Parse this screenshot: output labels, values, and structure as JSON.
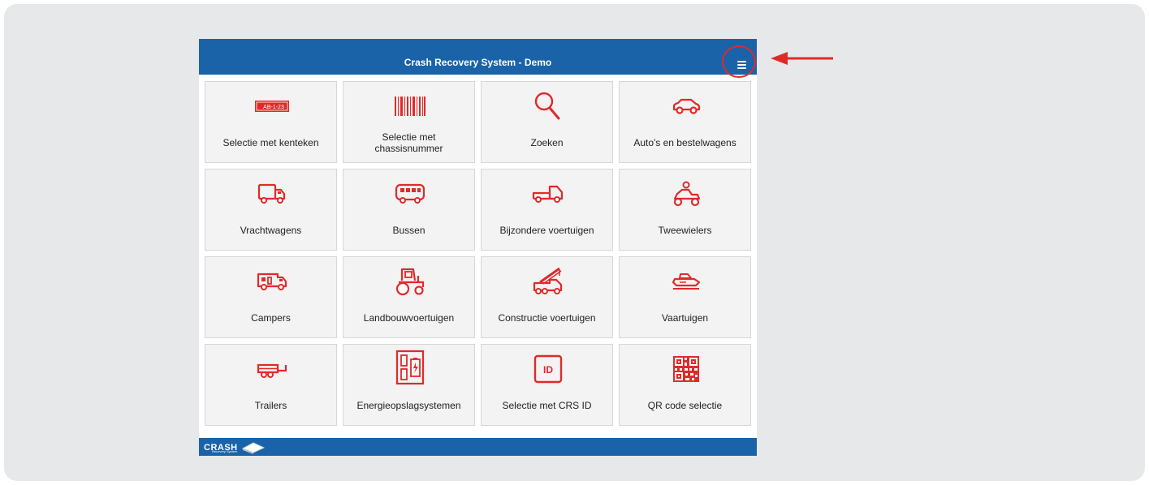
{
  "header": {
    "title": "Crash Recovery System - Demo"
  },
  "menu_button": {
    "icon": "hamburger-menu-icon"
  },
  "annotation": {
    "highlight_color": "#e02a2a"
  },
  "colors": {
    "brand": "#1a63a9",
    "icon": "#e02a2a",
    "tile_bg": "#f3f3f3"
  },
  "tiles": [
    {
      "label": "Selectie met kenteken",
      "icon": "license-plate-icon",
      "plate_text": "AB-1-23"
    },
    {
      "label": "Selectie met chassisnummer",
      "icon": "barcode-icon"
    },
    {
      "label": "Zoeken",
      "icon": "search-icon"
    },
    {
      "label": "Auto's en bestelwagens",
      "icon": "car-icon"
    },
    {
      "label": "Vrachtwagens",
      "icon": "truck-icon"
    },
    {
      "label": "Bussen",
      "icon": "bus-icon"
    },
    {
      "label": "Bijzondere voertuigen",
      "icon": "special-vehicle-icon"
    },
    {
      "label": "Tweewielers",
      "icon": "motorcycle-icon"
    },
    {
      "label": "Campers",
      "icon": "camper-icon"
    },
    {
      "label": "Landbouwvoertuigen",
      "icon": "tractor-icon"
    },
    {
      "label": "Constructie voertuigen",
      "icon": "crane-truck-icon"
    },
    {
      "label": "Vaartuigen",
      "icon": "boat-icon"
    },
    {
      "label": "Trailers",
      "icon": "trailer-icon"
    },
    {
      "label": "Energieopslagsystemen",
      "icon": "battery-storage-icon"
    },
    {
      "label": "Selectie met CRS ID",
      "icon": "id-icon",
      "id_text": "ID"
    },
    {
      "label": "QR code selectie",
      "icon": "qr-code-icon"
    }
  ],
  "footer": {
    "logo_text": "CRASH",
    "logo_sub": "Recovery System"
  }
}
